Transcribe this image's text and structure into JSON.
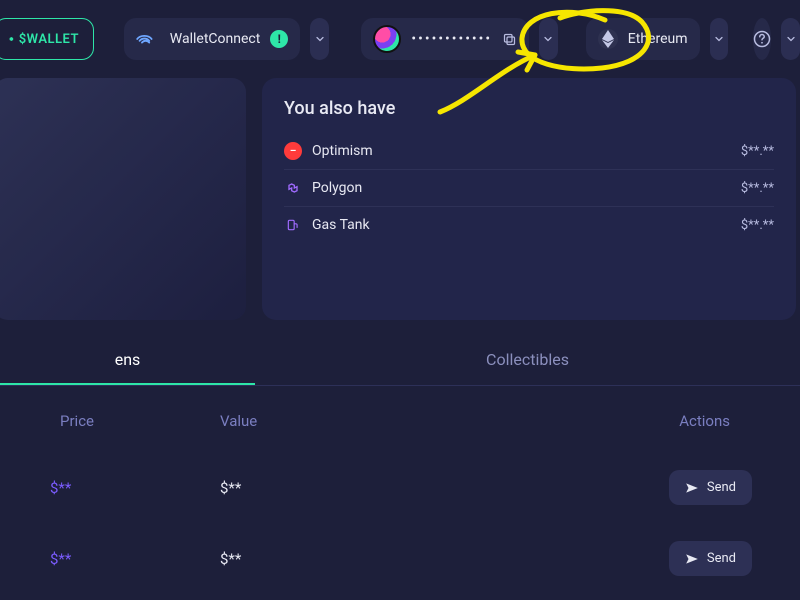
{
  "topbar": {
    "wallet_label": "$WALLET",
    "walletconnect_label": "WalletConnect",
    "account_mask": "••••••••••••",
    "network_label": "Ethereum",
    "status_badge": "!"
  },
  "also_have": {
    "heading": "You also have",
    "rows": [
      {
        "name": "Optimism",
        "value": "$**.**"
      },
      {
        "name": "Polygon",
        "value": "$**.**"
      },
      {
        "name": "Gas Tank",
        "value": "$**.**"
      }
    ]
  },
  "tabs": {
    "tokens": "ens",
    "collectibles": "Collectibles"
  },
  "columns": {
    "price": "Price",
    "value": "Value",
    "actions": "Actions"
  },
  "token_rows": [
    {
      "price": "$**",
      "value": "$**",
      "send_label": "Send"
    },
    {
      "price": "$**",
      "value": "$**",
      "send_label": "Send"
    }
  ]
}
